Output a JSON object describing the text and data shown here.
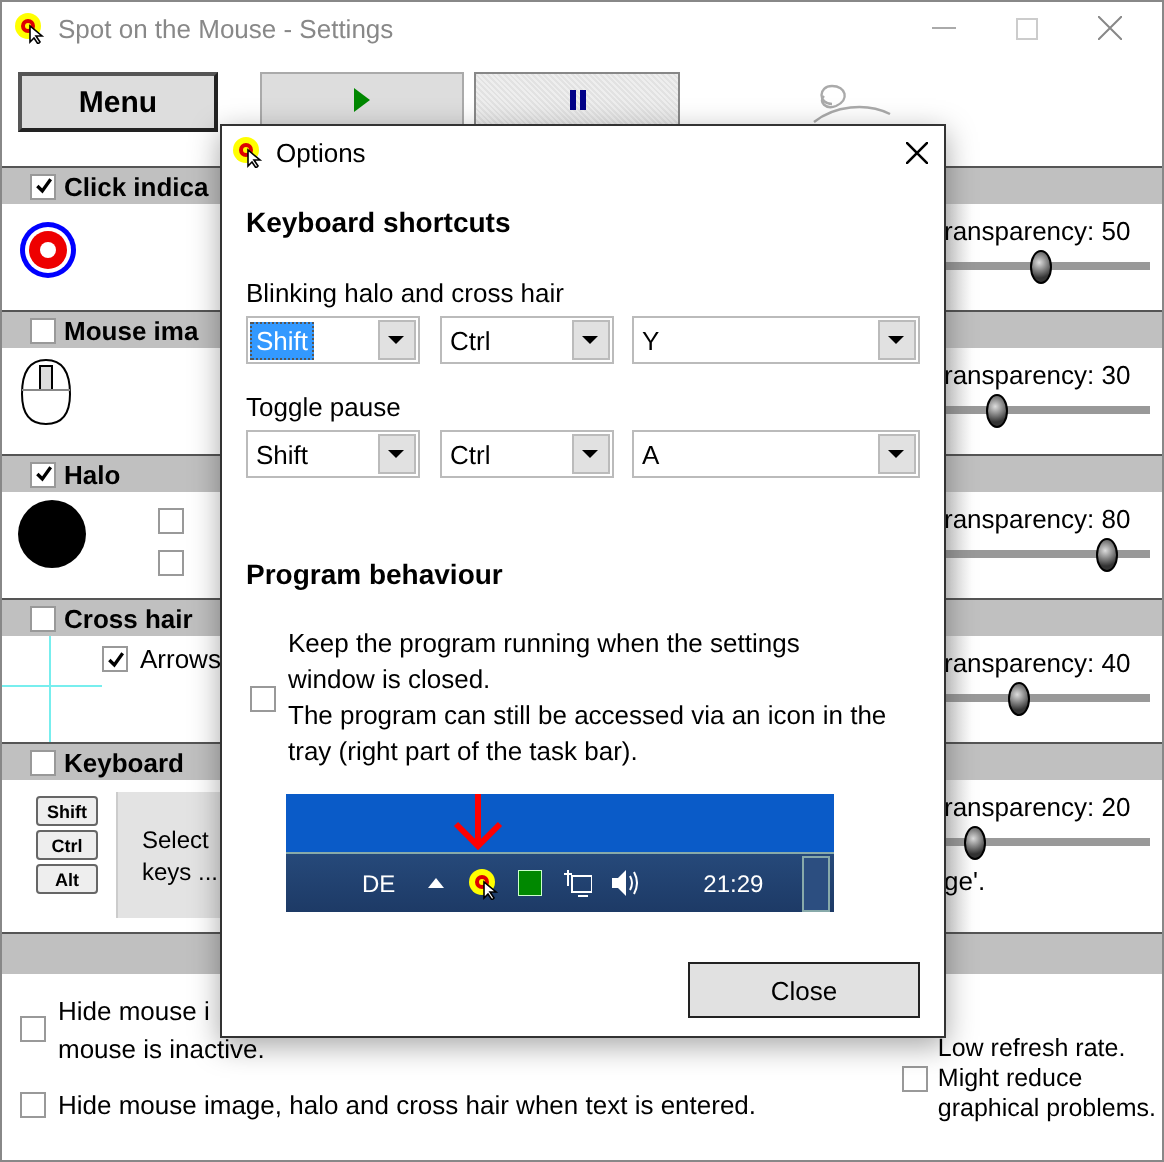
{
  "window": {
    "title": "Spot on the Mouse - Settings"
  },
  "toolbar": {
    "menu_button": "Menu",
    "pause_pressed": true
  },
  "sections": [
    {
      "kind": "click",
      "title": "Click indica",
      "checked": true,
      "transparency": "ransparency: 50",
      "level": 0.5
    },
    {
      "kind": "mouse",
      "title": "Mouse ima",
      "checked": false,
      "transparency": "ransparency: 30",
      "level": 0.3
    },
    {
      "kind": "halo",
      "title": "Halo",
      "checked": true,
      "options": [
        {
          "checked": false
        },
        {
          "checked": false
        }
      ],
      "transparency": "ransparency: 80",
      "level": 0.8
    },
    {
      "kind": "crosshair",
      "title": "Cross hair",
      "checked": false,
      "options": [
        {
          "label": "Arrows",
          "checked": true
        }
      ],
      "transparency": "ransparency: 40",
      "level": 0.4
    },
    {
      "kind": "keyboard",
      "title": "Keyboard",
      "checked": false,
      "keys": [
        "Shift",
        "Ctrl",
        "Alt"
      ],
      "select_button": "Select\nkeys ...",
      "transparency": "ransparency: 20",
      "level": 0.2,
      "note": "ge'."
    }
  ],
  "bottom": {
    "options": [
      {
        "label": "Hide mouse i\nmouse is inactive.",
        "checked": false
      },
      {
        "label": "Hide mouse image, halo and cross hair when text is entered.",
        "checked": false
      }
    ],
    "refresh": {
      "label": "Low refresh rate.\nMight reduce\ngraphical problems.",
      "checked": false
    }
  },
  "dialog": {
    "title": "Options",
    "shortcuts": {
      "heading": "Keyboard shortcuts",
      "groups": [
        {
          "label": "Blinking halo and cross hair",
          "fields": [
            {
              "value": "Shift",
              "focused": true
            },
            {
              "value": "Ctrl",
              "focused": false
            },
            {
              "value": "Y",
              "focused": false
            }
          ]
        },
        {
          "label": "Toggle pause",
          "fields": [
            {
              "value": "Shift",
              "focused": false
            },
            {
              "value": "Ctrl",
              "focused": false
            },
            {
              "value": "A",
              "focused": false
            }
          ]
        }
      ]
    },
    "behaviour": {
      "heading": "Program behaviour",
      "keep_running": {
        "checked": false,
        "label": "Keep the program running when the settings window is closed.\nThe program can still be accessed via an icon in the tray (right part of the task bar)."
      },
      "taskbar": {
        "language": "DE",
        "clock": "21:29"
      }
    },
    "close_button": "Close"
  }
}
